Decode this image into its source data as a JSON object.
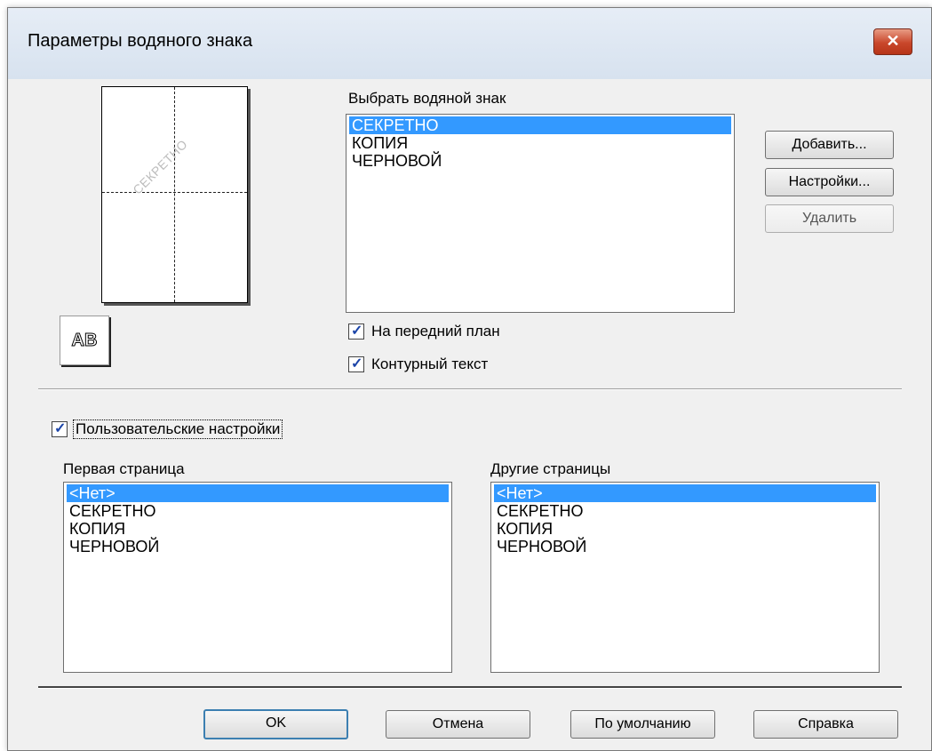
{
  "dialog": {
    "title": "Параметры водяного знака",
    "close_icon": "close-icon"
  },
  "preview": {
    "watermark_text": "СЕКРЕТНО",
    "font_button_label": "AB"
  },
  "watermark_select": {
    "label": "Выбрать водяной знак",
    "items": [
      "СЕКРЕТНО",
      "КОПИЯ",
      "ЧЕРНОВОЙ"
    ],
    "selected": "СЕКРЕТНО"
  },
  "buttons": {
    "add": "Добавить...",
    "settings": "Настройки...",
    "delete": "Удалить"
  },
  "options": {
    "foreground": {
      "label": "На передний план",
      "checked": true
    },
    "outline": {
      "label": "Контурный текст",
      "checked": true
    }
  },
  "custom_settings": {
    "label": "Пользовательские настройки",
    "checked": true
  },
  "first_page": {
    "label": "Первая страница",
    "items": [
      "<Нет>",
      "СЕКРЕТНО",
      "КОПИЯ",
      "ЧЕРНОВОЙ"
    ],
    "selected": "<Нет>"
  },
  "other_pages": {
    "label": "Другие страницы",
    "items": [
      "<Нет>",
      "СЕКРЕТНО",
      "КОПИЯ",
      "ЧЕРНОВОЙ"
    ],
    "selected": "<Нет>"
  },
  "footer": {
    "ok": "OK",
    "cancel": "Отмена",
    "default": "По умолчанию",
    "help": "Справка"
  },
  "colors": {
    "selection": "#3399ff",
    "close_button": "#c9472b",
    "checkmark": "#1b44a8"
  }
}
